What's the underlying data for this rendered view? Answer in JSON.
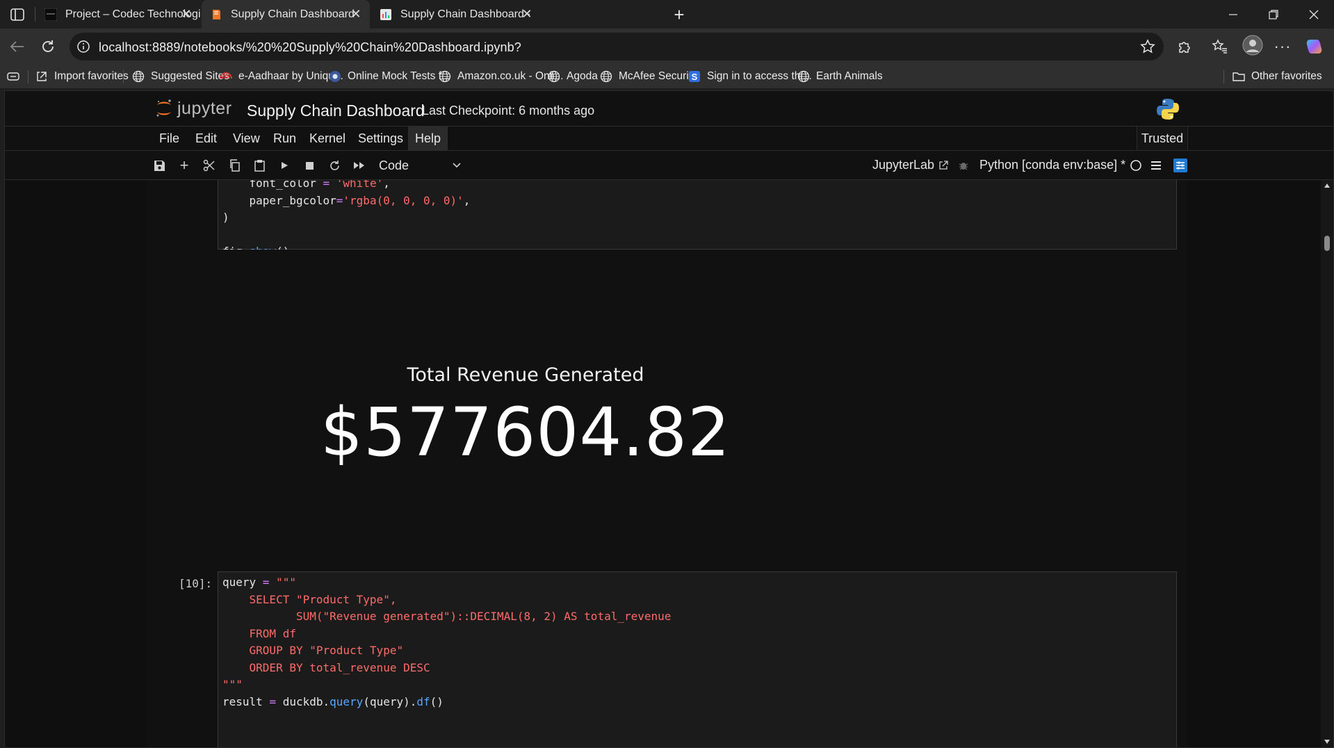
{
  "browser": {
    "tabs": [
      {
        "title": "Project – Codec Technologies",
        "favicon": "codec-favicon",
        "active": false
      },
      {
        "title": "Supply Chain Dashboard",
        "favicon": "jupyter-notebook-favicon",
        "active": true
      },
      {
        "title": "Supply Chain Dashboard · Streaml",
        "favicon": "streamlit-favicon",
        "active": false
      }
    ],
    "url": "localhost:8889/notebooks/%20%20Supply%20Chain%20Dashboard.ipynb?",
    "favorites": [
      {
        "label": "Import favorites",
        "icon": "import-icon"
      },
      {
        "label": "Suggested Sites",
        "icon": "globe-icon"
      },
      {
        "label": "e-Aadhaar by Uniqu...",
        "icon": "aadhaar-icon"
      },
      {
        "label": "Online Mock Tests f...",
        "icon": "mock-tests-icon"
      },
      {
        "label": "Amazon.co.uk - Onli...",
        "icon": "globe-icon"
      },
      {
        "label": "Agoda",
        "icon": "globe-icon"
      },
      {
        "label": "McAfee Security",
        "icon": "globe-icon"
      },
      {
        "label": "Sign in to access thi...",
        "icon": "s-icon"
      },
      {
        "label": "Earth Animals",
        "icon": "globe-icon"
      }
    ],
    "other_favorites": "Other favorites"
  },
  "jupyter": {
    "logo_text": "jupyter",
    "notebook_title": "Supply Chain Dashboard",
    "checkpoint": "Last Checkpoint: 6 months ago",
    "menu": [
      "File",
      "Edit",
      "View",
      "Run",
      "Kernel",
      "Settings",
      "Help"
    ],
    "trusted": "Trusted",
    "cell_type": "Code",
    "jupyterlab_link": "JupyterLab",
    "kernel": "Python [conda env:base] *"
  },
  "cells": {
    "prev_code_lines": [
      "    font_color = 'white',",
      "    paper_bgcolor='rgba(0, 0, 0, 0)',",
      ")",
      "",
      "fig.show()"
    ],
    "kpi": {
      "title": "Total Revenue Generated",
      "value": "$577604.82"
    },
    "cell10": {
      "prompt": "[10]:",
      "lines": [
        "query = \"\"\"",
        "    SELECT \"Product Type\",",
        "           SUM(\"Revenue generated\")::DECIMAL(8, 2) AS total_revenue",
        "    FROM df",
        "    GROUP BY \"Product Type\"",
        "    ORDER BY total_revenue DESC",
        "\"\"\"",
        "result = duckdb.query(query).df()"
      ]
    }
  }
}
